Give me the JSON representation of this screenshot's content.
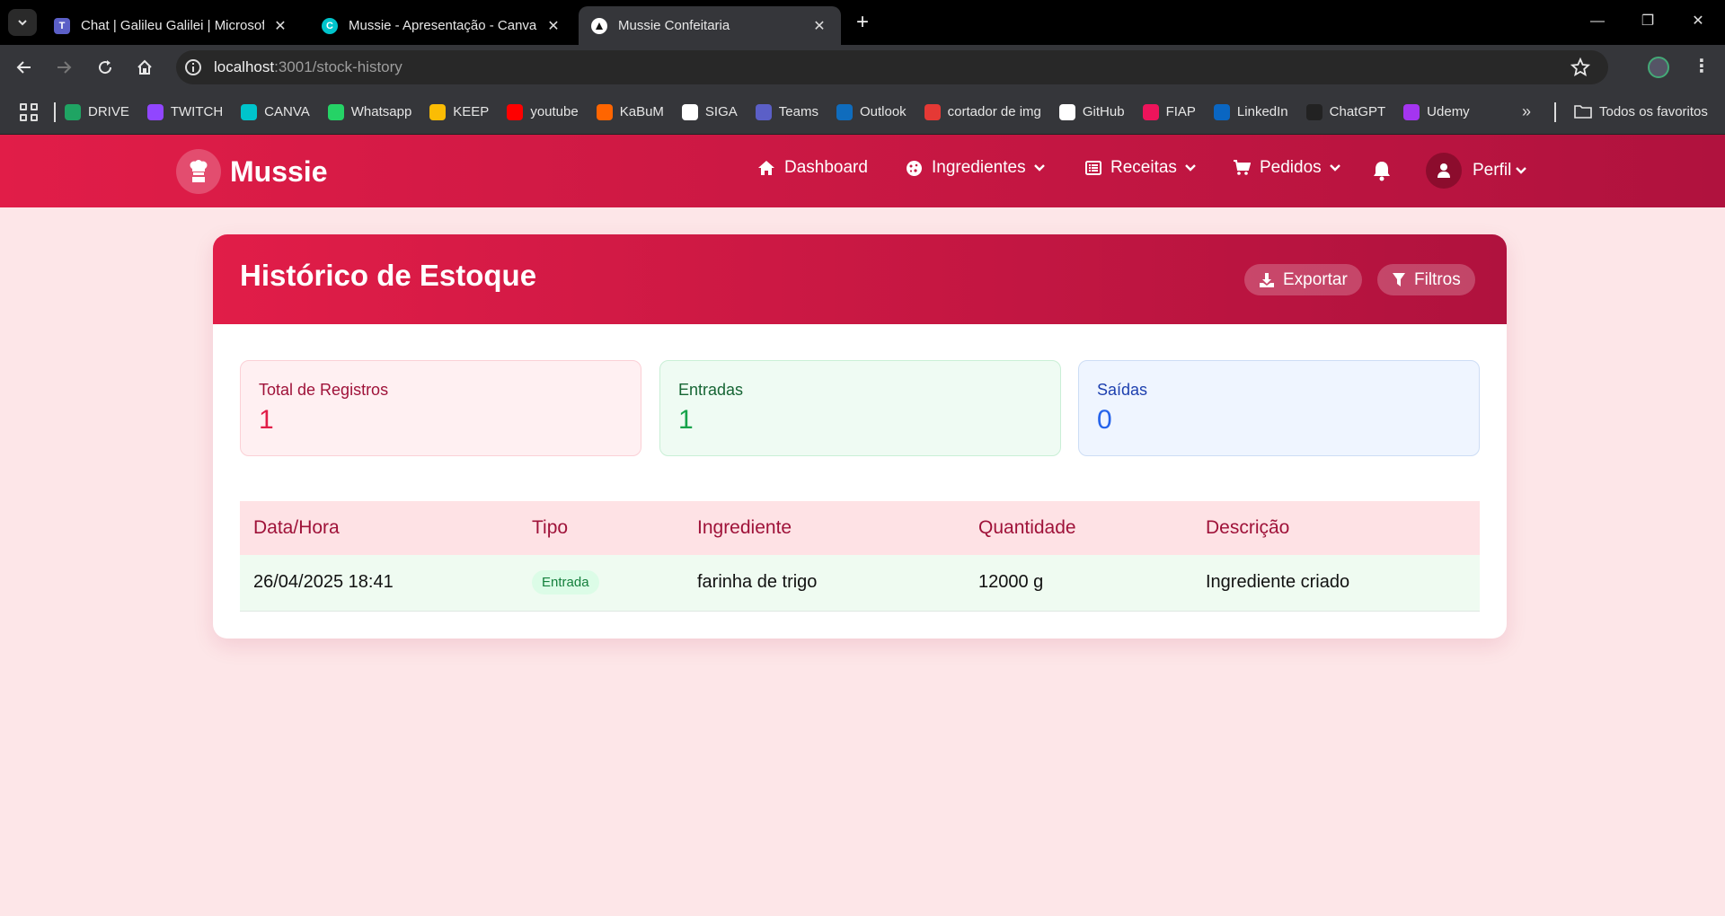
{
  "browser": {
    "tabs": [
      {
        "title": "Chat | Galileu Galilei | Microsoft",
        "icon": "teams-icon",
        "color": "#5b5fc7"
      },
      {
        "title": "Mussie - Apresentação - Canva",
        "icon": "canva-icon",
        "color": "#00c4cc"
      },
      {
        "title": "Mussie Confeitaria",
        "icon": "app-icon",
        "color": "#ffffff",
        "active": true
      }
    ],
    "url_host": "localhost",
    "url_path": ":3001/stock-history",
    "bookmarks": [
      {
        "label": "DRIVE",
        "icon": "drive-icon",
        "color": "#1fa463"
      },
      {
        "label": "TWITCH",
        "icon": "twitch-icon",
        "color": "#9146ff"
      },
      {
        "label": "CANVA",
        "icon": "canva-icon",
        "color": "#00c4cc"
      },
      {
        "label": "Whatsapp",
        "icon": "whatsapp-icon",
        "color": "#25d366"
      },
      {
        "label": "KEEP",
        "icon": "keep-icon",
        "color": "#fbbc04"
      },
      {
        "label": "youtube",
        "icon": "youtube-icon",
        "color": "#ff0000"
      },
      {
        "label": "KaBuM",
        "icon": "kabum-icon",
        "color": "#ff6500"
      },
      {
        "label": "SIGA",
        "icon": "siga-icon",
        "color": "#ffffff"
      },
      {
        "label": "Teams",
        "icon": "teams-icon",
        "color": "#5b5fc7"
      },
      {
        "label": "Outlook",
        "icon": "outlook-icon",
        "color": "#0f6cbd"
      },
      {
        "label": "cortador de img",
        "icon": "cortador-icon",
        "color": "#e53935"
      },
      {
        "label": "GitHub",
        "icon": "github-icon",
        "color": "#ffffff"
      },
      {
        "label": "FIAP",
        "icon": "fiap-icon",
        "color": "#ed145b"
      },
      {
        "label": "LinkedIn",
        "icon": "linkedin-icon",
        "color": "#0a66c2"
      },
      {
        "label": "ChatGPT",
        "icon": "chatgpt-icon",
        "color": "#222222"
      },
      {
        "label": "Udemy",
        "icon": "udemy-icon",
        "color": "#a435f0"
      }
    ],
    "all_bookmarks_label": "Todos os favoritos"
  },
  "app": {
    "brand": "Mussie",
    "nav": {
      "dashboard": "Dashboard",
      "ingredientes": "Ingredientes",
      "receitas": "Receitas",
      "pedidos": "Pedidos",
      "perfil": "Perfil"
    },
    "accent": "#e11d48"
  },
  "page": {
    "title": "Histórico de Estoque",
    "export_label": "Exportar",
    "filters_label": "Filtros",
    "stats": {
      "total": {
        "label": "Total de Registros",
        "value": "1"
      },
      "entradas": {
        "label": "Entradas",
        "value": "1"
      },
      "saidas": {
        "label": "Saídas",
        "value": "0"
      }
    },
    "table": {
      "headers": [
        "Data/Hora",
        "Tipo",
        "Ingrediente",
        "Quantidade",
        "Descrição"
      ],
      "rows": [
        {
          "datetime": "26/04/2025 18:41",
          "type": "Entrada",
          "ingredient": "farinha de trigo",
          "quantity": "12000 g",
          "description": "Ingrediente criado"
        }
      ]
    }
  }
}
